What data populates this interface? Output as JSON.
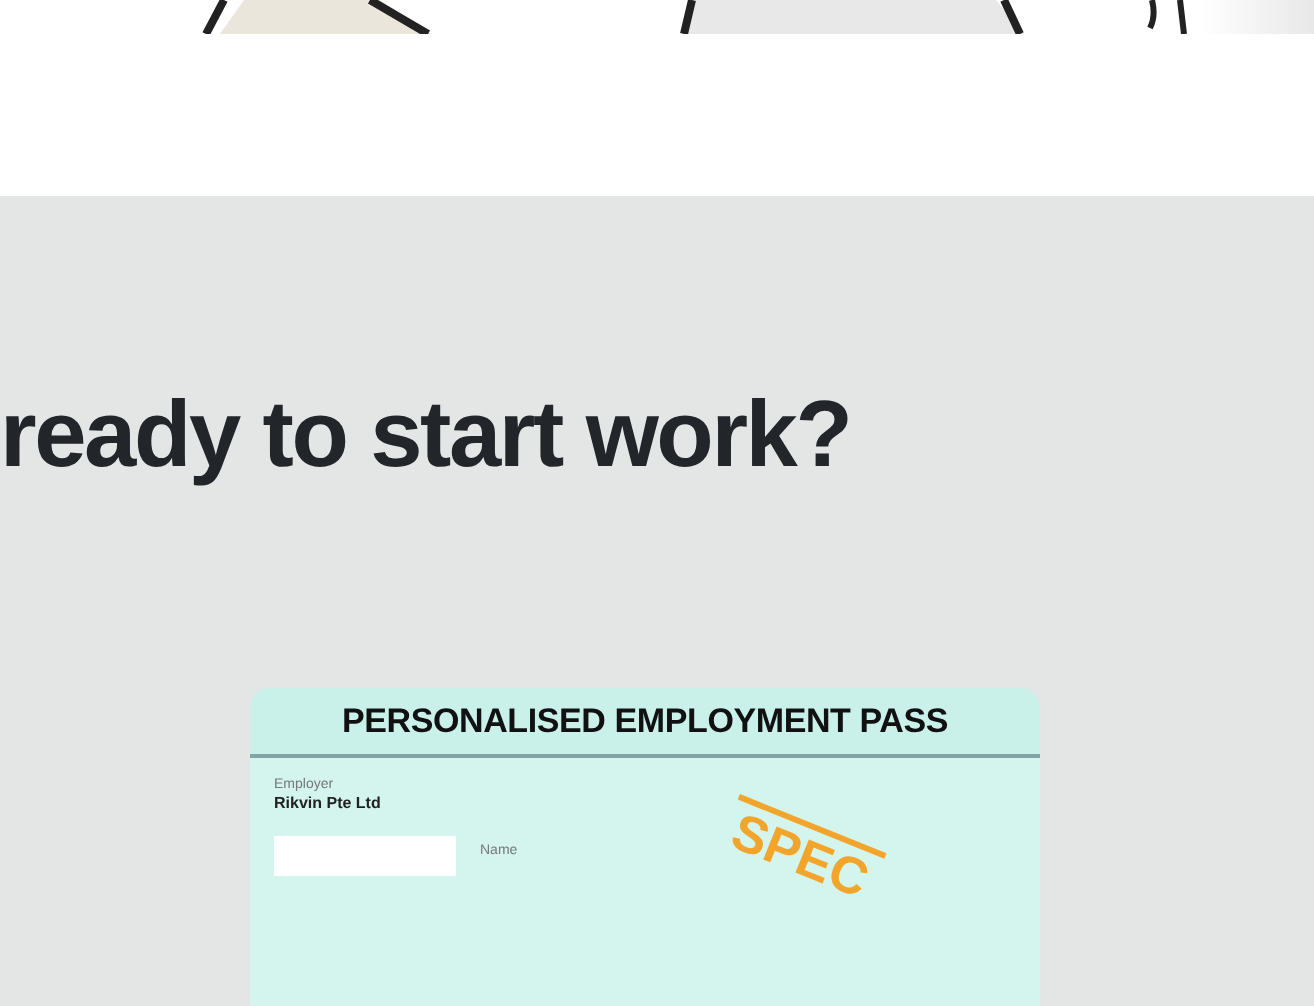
{
  "hero_section": {
    "heading": "ready to start work?"
  },
  "pass_card": {
    "title": "PERSONALISED EMPLOYMENT PASS",
    "employer_label": "Employer",
    "employer": "Rikvin Pte Ltd",
    "name_label": "Name",
    "stamp": "SPEC"
  }
}
